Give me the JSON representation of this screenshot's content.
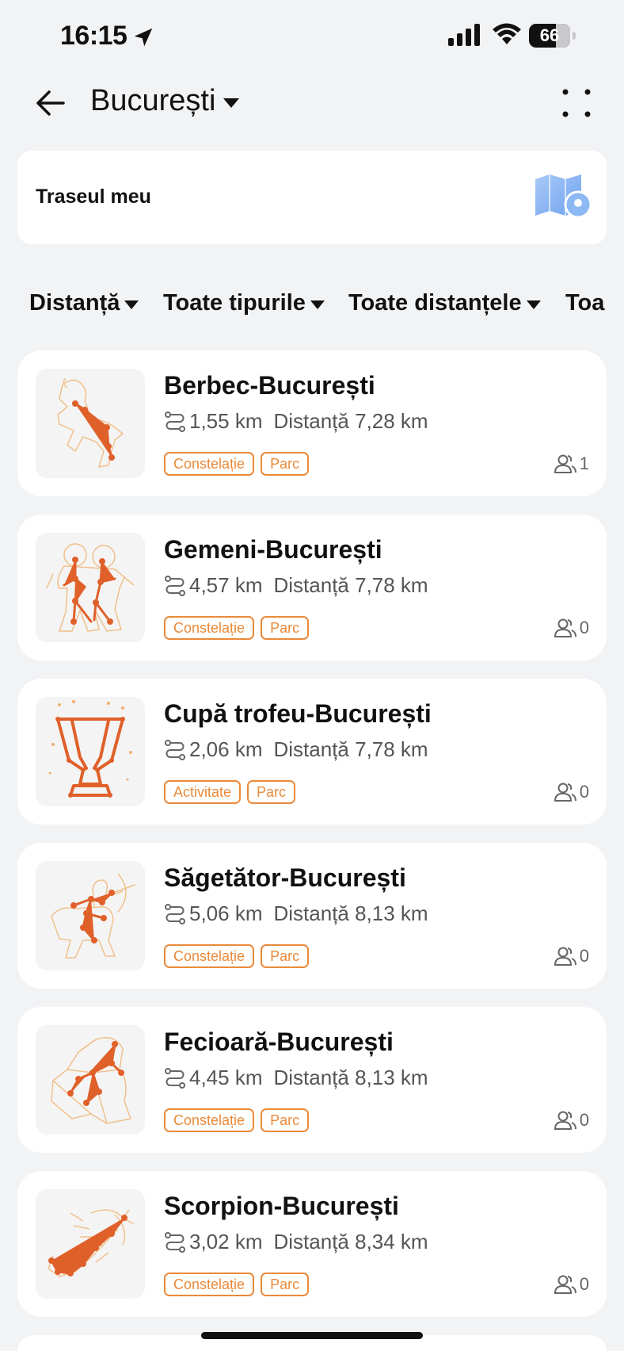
{
  "status_bar": {
    "time": "16:15",
    "battery": "66",
    "battery_level": 0.66
  },
  "nav": {
    "title": "București"
  },
  "my_route": {
    "label": "Traseul meu"
  },
  "filters": [
    {
      "label": "Distanță"
    },
    {
      "label": "Toate tipurile"
    },
    {
      "label": "Toate distanțele"
    },
    {
      "label": "Toa"
    }
  ],
  "routes": [
    {
      "title": "Berbec-București",
      "length": "1,55 km",
      "distance": "Distanță 7,28 km",
      "tags": [
        "Constelație",
        "Parc"
      ],
      "participants": "1",
      "icon": "aries-constellation-icon"
    },
    {
      "title": "Gemeni-București",
      "length": "4,57 km",
      "distance": "Distanță 7,78 km",
      "tags": [
        "Constelație",
        "Parc"
      ],
      "participants": "0",
      "icon": "gemini-constellation-icon"
    },
    {
      "title": "Cupă trofeu-București",
      "length": "2,06 km",
      "distance": "Distanță 7,78 km",
      "tags": [
        "Activitate",
        "Parc"
      ],
      "participants": "0",
      "icon": "trophy-cup-icon"
    },
    {
      "title": "Săgetător-București",
      "length": "5,06 km",
      "distance": "Distanță 8,13 km",
      "tags": [
        "Constelație",
        "Parc"
      ],
      "participants": "0",
      "icon": "sagittarius-constellation-icon"
    },
    {
      "title": "Fecioară-București",
      "length": "4,45 km",
      "distance": "Distanță 8,13 km",
      "tags": [
        "Constelație",
        "Parc"
      ],
      "participants": "0",
      "icon": "virgo-constellation-icon"
    },
    {
      "title": "Scorpion-București",
      "length": "3,02 km",
      "distance": "Distanță 8,34 km",
      "tags": [
        "Constelație",
        "Parc"
      ],
      "participants": "0",
      "icon": "scorpio-constellation-icon"
    }
  ],
  "colors": {
    "accent": "#e98a3a",
    "constellation": "#e0602a",
    "background": "#f2f3f5"
  }
}
